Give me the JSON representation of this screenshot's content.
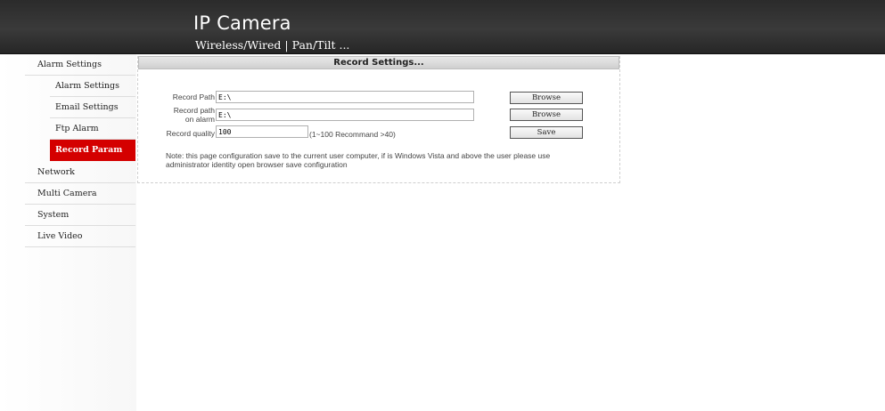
{
  "header": {
    "title": "IP Camera",
    "subtitle": "Wireless/Wired  |  Pan/Tilt ..."
  },
  "sidebar": {
    "items": [
      {
        "label": "Alarm Settings",
        "level": "top"
      },
      {
        "label": "Alarm Settings",
        "level": "sub"
      },
      {
        "label": "Email Settings",
        "level": "sub"
      },
      {
        "label": "Ftp Alarm",
        "level": "sub"
      },
      {
        "label": "Record Param",
        "level": "sub",
        "active": true
      },
      {
        "label": "Network",
        "level": "top"
      },
      {
        "label": "Multi Camera",
        "level": "top"
      },
      {
        "label": "System",
        "level": "top"
      },
      {
        "label": "Live Video",
        "level": "top"
      }
    ]
  },
  "panel": {
    "title": "Record Settings...",
    "record_path": {
      "label": "Record Path",
      "value": "E:\\",
      "button": "Browse"
    },
    "record_path_alarm": {
      "label_line1": "Record path",
      "label_line2": "on alarm",
      "value": "E:\\",
      "button": "Browse"
    },
    "record_quality": {
      "label": "Record quality",
      "value": "100",
      "hint": "(1~100 Recommand >40)",
      "button": "Save"
    },
    "note_line1": "Note: this page configuration save to the current user computer, if is Windows Vista and above the user please use",
    "note_line2": "administrator identity open browser save configuration"
  },
  "colors": {
    "header_bg": "#2f2f2f",
    "active_nav": "#d40000",
    "panel_header": "#d6d6d6"
  }
}
